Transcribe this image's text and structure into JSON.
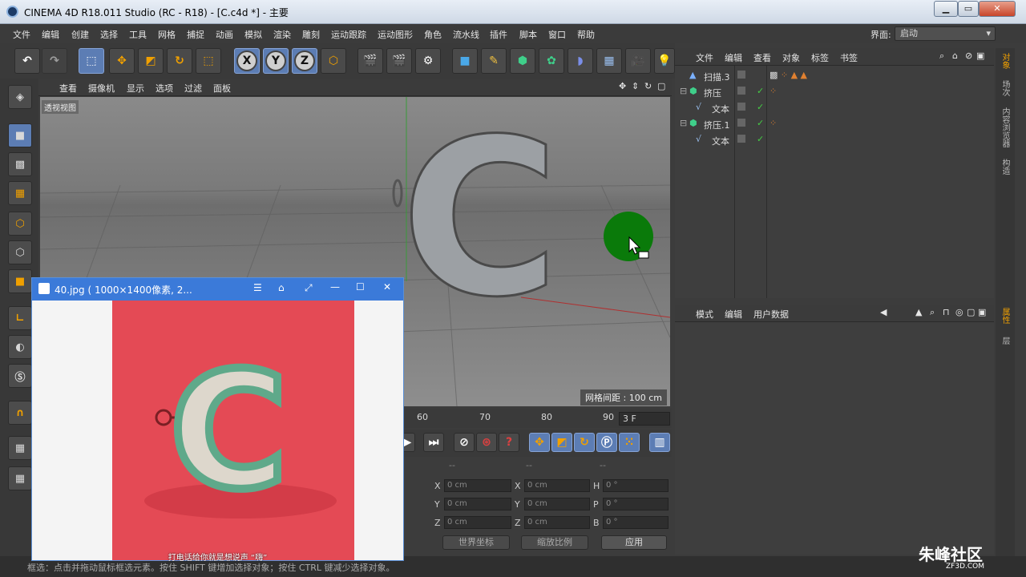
{
  "window": {
    "title": "CINEMA 4D R18.011 Studio (RC - R18) - [C.c4d *] - 主要",
    "minimize": "▁",
    "restore": "▭",
    "close": "✕"
  },
  "menu": [
    "文件",
    "编辑",
    "创建",
    "选择",
    "工具",
    "网格",
    "捕捉",
    "动画",
    "模拟",
    "渲染",
    "雕刻",
    "运动跟踪",
    "运动图形",
    "角色",
    "流水线",
    "插件",
    "脚本",
    "窗口",
    "帮助"
  ],
  "layout": {
    "label": "界面:",
    "value": "启动"
  },
  "toolbar": {
    "axis_x": "X",
    "axis_y": "Y",
    "axis_z": "Z"
  },
  "viewport": {
    "menu": [
      "查看",
      "摄像机",
      "显示",
      "选项",
      "过滤",
      "面板"
    ],
    "label": "透视视图",
    "grid_info": "网格间距 : 100 cm",
    "object_letter": "C"
  },
  "timeline": {
    "ticks": [
      "60",
      "70",
      "80",
      "90"
    ],
    "frame": "3 F"
  },
  "coords": {
    "headers": [
      "--",
      "--",
      "--"
    ],
    "rows": [
      {
        "l1": "X",
        "v1": "0 cm",
        "l2": "X",
        "v2": "0 cm",
        "l3": "H",
        "v3": "0 °"
      },
      {
        "l1": "Y",
        "v1": "0 cm",
        "l2": "Y",
        "v2": "0 cm",
        "l3": "P",
        "v3": "0 °"
      },
      {
        "l1": "Z",
        "v1": "0 cm",
        "l2": "Z",
        "v2": "0 cm",
        "l3": "B",
        "v3": "0 °"
      }
    ],
    "world": "世界坐标",
    "scale": "缩放比例",
    "apply": "应用"
  },
  "objects": {
    "menu": [
      "文件",
      "编辑",
      "查看",
      "对象",
      "标签",
      "书签"
    ],
    "items": [
      {
        "name": "扫描.3",
        "indent": 0
      },
      {
        "name": "挤压",
        "indent": 0
      },
      {
        "name": "文本",
        "indent": 1
      },
      {
        "name": "挤压.1",
        "indent": 0
      },
      {
        "name": "文本",
        "indent": 1
      }
    ]
  },
  "attributes": {
    "menu": [
      "模式",
      "编辑",
      "用户数据"
    ]
  },
  "right_tabs": [
    "对象",
    "场次",
    "内容浏览器",
    "构造",
    "属性",
    "层"
  ],
  "status": "框选：点击并拖动鼠标框选元素。按住 SHIFT 键增加选择对象；按住 CTRL 键减少选择对象。",
  "image_window": {
    "title": "40.jpg ( 1000×1400像素, 2...",
    "caption": "打电话给你就是想说声 “嗨”",
    "letter": "C"
  },
  "watermark": {
    "brand": "朱峰社区",
    "url": "ZF3D.COM"
  },
  "colors": {
    "accent": "#5c7db4",
    "photo_bg": "#e44a55",
    "letter_green": "#5fa98a",
    "cursor_circle": "#0a7a0a"
  }
}
